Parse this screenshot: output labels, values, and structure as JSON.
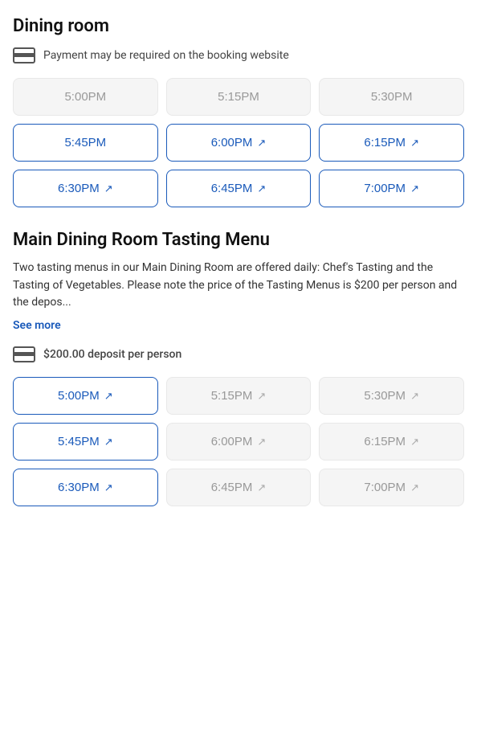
{
  "sections": [
    {
      "id": "dining-room",
      "title": "Dining room",
      "payment_notice": "Payment may be required on the booking website",
      "time_slots": [
        {
          "time": "5:00PM",
          "available": false,
          "external": false
        },
        {
          "time": "5:15PM",
          "available": false,
          "external": false
        },
        {
          "time": "5:30PM",
          "available": false,
          "external": false
        },
        {
          "time": "5:45PM",
          "available": true,
          "external": false
        },
        {
          "time": "6:00PM",
          "available": true,
          "external": true
        },
        {
          "time": "6:15PM",
          "available": true,
          "external": true
        },
        {
          "time": "6:30PM",
          "available": true,
          "external": true
        },
        {
          "time": "6:45PM",
          "available": true,
          "external": true
        },
        {
          "time": "7:00PM",
          "available": true,
          "external": true
        }
      ]
    },
    {
      "id": "tasting-menu",
      "title": "Main Dining Room Tasting Menu",
      "description": "Two tasting menus in our Main Dining Room are offered daily: Chef's Tasting and the Tasting of Vegetables. Please note the price of the Tasting Menus is $200 per person and the depos...",
      "see_more_label": "See more",
      "deposit_notice": "$200.00 deposit per person",
      "time_slots": [
        {
          "time": "5:00PM",
          "available": true,
          "external": true
        },
        {
          "time": "5:15PM",
          "available": false,
          "external": true
        },
        {
          "time": "5:30PM",
          "available": false,
          "external": true
        },
        {
          "time": "5:45PM",
          "available": true,
          "external": true
        },
        {
          "time": "6:00PM",
          "available": false,
          "external": true
        },
        {
          "time": "6:15PM",
          "available": false,
          "external": true
        },
        {
          "time": "6:30PM",
          "available": true,
          "external": true
        },
        {
          "time": "6:45PM",
          "available": false,
          "external": true
        },
        {
          "time": "7:00PM",
          "available": false,
          "external": true
        }
      ]
    }
  ],
  "icons": {
    "external_link": "⊡",
    "card": "card"
  }
}
